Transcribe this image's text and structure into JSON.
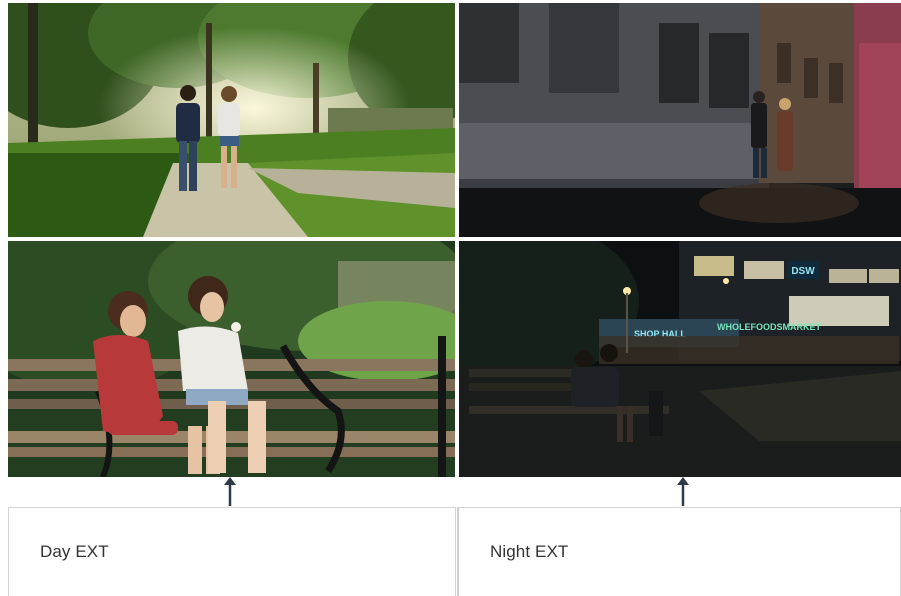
{
  "frames": [
    {
      "scene": "day-exterior-walk"
    },
    {
      "scene": "night-exterior-walk"
    },
    {
      "scene": "day-exterior-bench"
    },
    {
      "scene": "night-exterior-bench"
    }
  ],
  "signage": {
    "dsw": "DSW",
    "market": "WHOLEFOODSMARKET",
    "shop": "SHOP HALL"
  },
  "labels": {
    "day": "Day EXT",
    "night": "Night EXT"
  },
  "icons": [
    "arrow-up-icon"
  ],
  "colors": {
    "arrow": "#2f3a48",
    "label_text": "#333333",
    "box_border": "#d4d4d4"
  }
}
